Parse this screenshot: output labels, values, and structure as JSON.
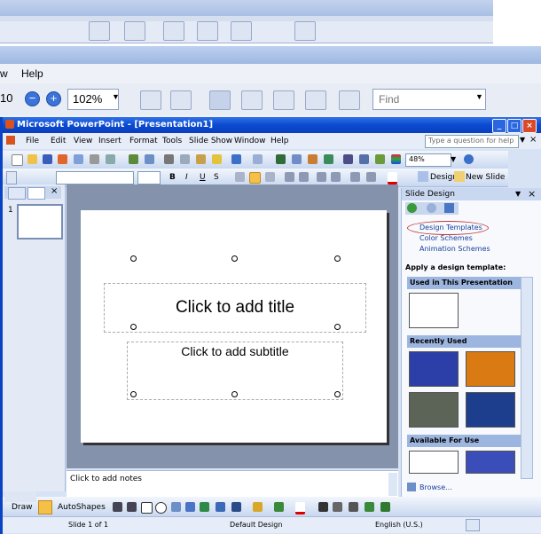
{
  "background": {
    "menu": [
      "w",
      "Help"
    ],
    "zoom_prefix": "10",
    "zoom": "102%",
    "find_placeholder": "Find"
  },
  "window": {
    "title": "Microsoft PowerPoint - [Presentation1]",
    "controls": [
      "_",
      "□",
      "×"
    ]
  },
  "menu": [
    "File",
    "Edit",
    "View",
    "Insert",
    "Format",
    "Tools",
    "Slide Show",
    "Window",
    "Help"
  ],
  "help_placeholder": "Type a question for help",
  "standard_toolbar": {
    "zoom": "48%"
  },
  "formatting_toolbar": {
    "bold": "B",
    "italic": "I",
    "underline": "U",
    "shadow": "S",
    "design": "Design",
    "new_slide": "New Slide"
  },
  "slide_panel": {
    "slide_number": "1"
  },
  "slide": {
    "title_placeholder": "Click to add title",
    "subtitle_placeholder": "Click to add subtitle"
  },
  "notes_placeholder": "Click to add notes",
  "task_pane": {
    "title": "Slide Design",
    "links": [
      "Design Templates",
      "Color Schemes",
      "Animation Schemes"
    ],
    "apply_label": "Apply a design template:",
    "sections": [
      "Used in This Presentation",
      "Recently Used",
      "Available For Use"
    ],
    "browse": "Browse...",
    "colors": {
      "blue_template": "#2c3fa8",
      "orange_template": "#d97a12",
      "gray_template": "#5c6458",
      "navy_template": "#1d3e8c"
    }
  },
  "drawing_toolbar": {
    "draw": "Draw",
    "autoshapes": "AutoShapes"
  },
  "status": {
    "slide": "Slide 1 of 1",
    "design": "Default Design",
    "language": "English (U.S.)"
  }
}
